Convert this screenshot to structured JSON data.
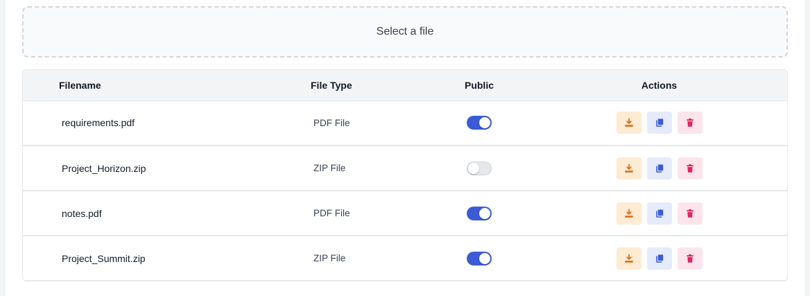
{
  "upload": {
    "label": "Select a file"
  },
  "table": {
    "headers": {
      "filename": "Filename",
      "file_type": "File Type",
      "public": "Public",
      "actions": "Actions"
    },
    "rows": [
      {
        "filename": "requirements.pdf",
        "file_type": "PDF File",
        "public": true
      },
      {
        "filename": "Project_Horizon.zip",
        "file_type": "ZIP File",
        "public": false
      },
      {
        "filename": "notes.pdf",
        "file_type": "PDF File",
        "public": true
      },
      {
        "filename": "Project_Summit.zip",
        "file_type": "ZIP File",
        "public": true
      }
    ]
  },
  "icons": {
    "download": "download-icon",
    "copy": "copy-icon",
    "delete": "trash-icon"
  },
  "colors": {
    "toggle_on": "#3b5bd6",
    "toggle_off": "#e5e7eb",
    "download_bg": "#fdebd3",
    "download_fg": "#e46a12",
    "copy_bg": "#e6ebfb",
    "copy_fg": "#3b5bd6",
    "delete_bg": "#fde4ec",
    "delete_fg": "#e0245e"
  }
}
